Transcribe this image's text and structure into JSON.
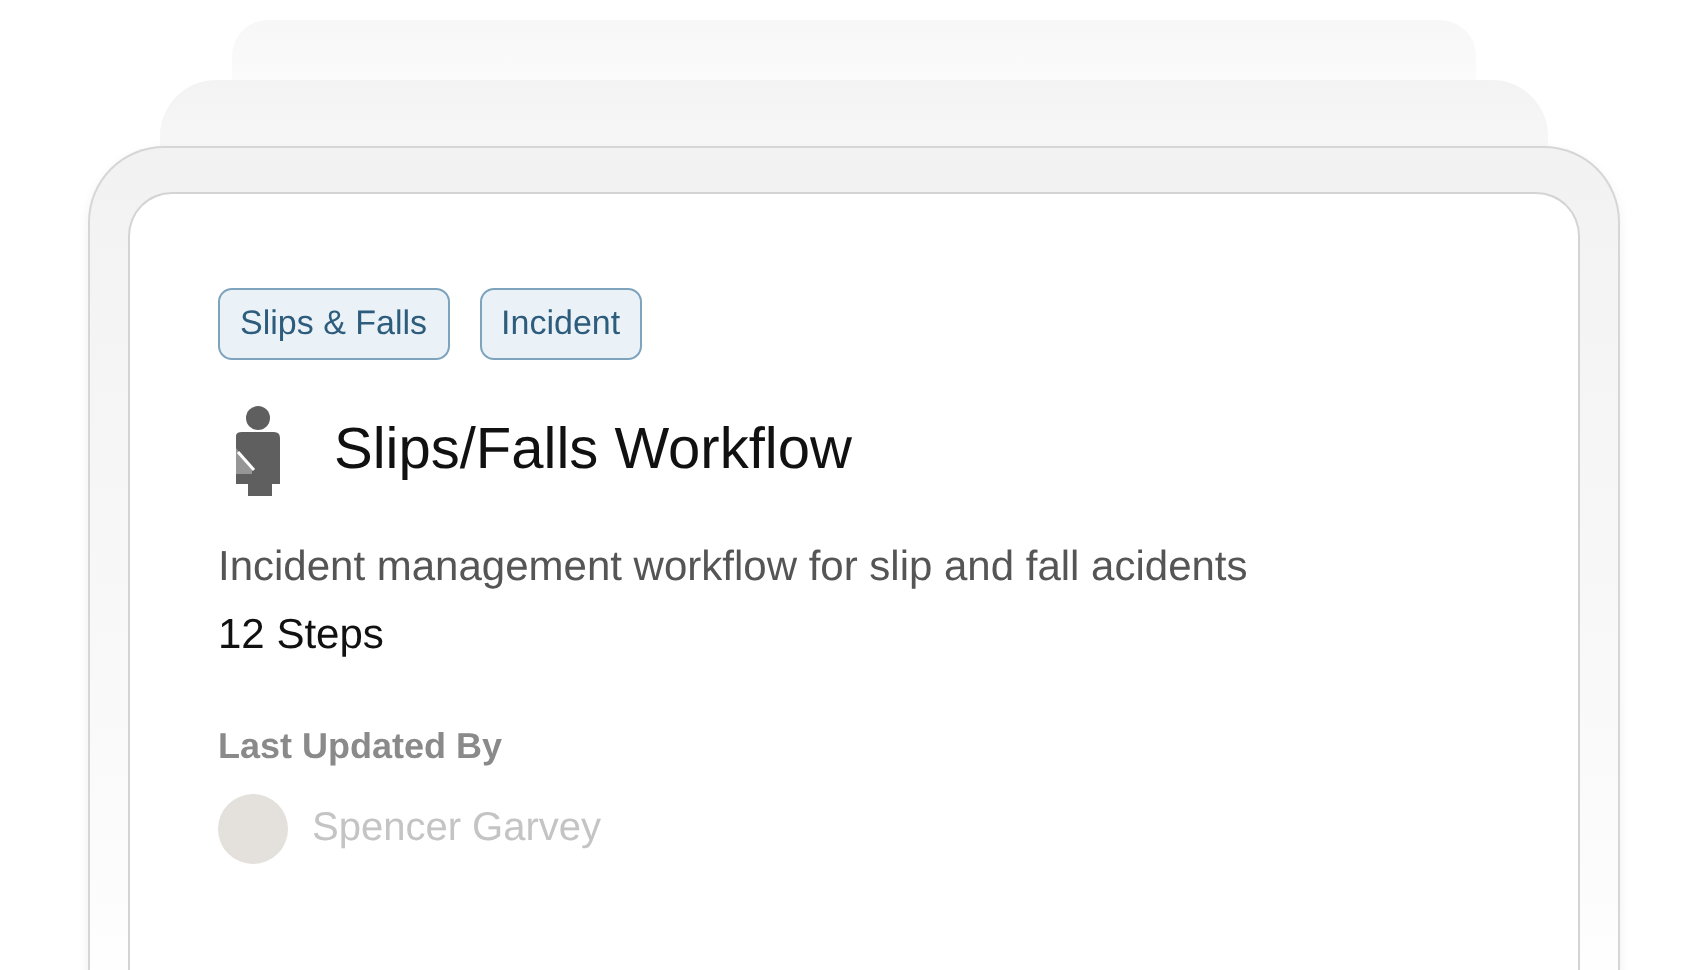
{
  "card": {
    "tags": [
      "Slips & Falls",
      "Incident"
    ],
    "title": "Slips/Falls Workflow",
    "description": "Incident management workflow for slip and fall acidents",
    "steps": "12 Steps",
    "updated_label": "Last Updated By",
    "updated_by": "Spencer Garvey"
  }
}
